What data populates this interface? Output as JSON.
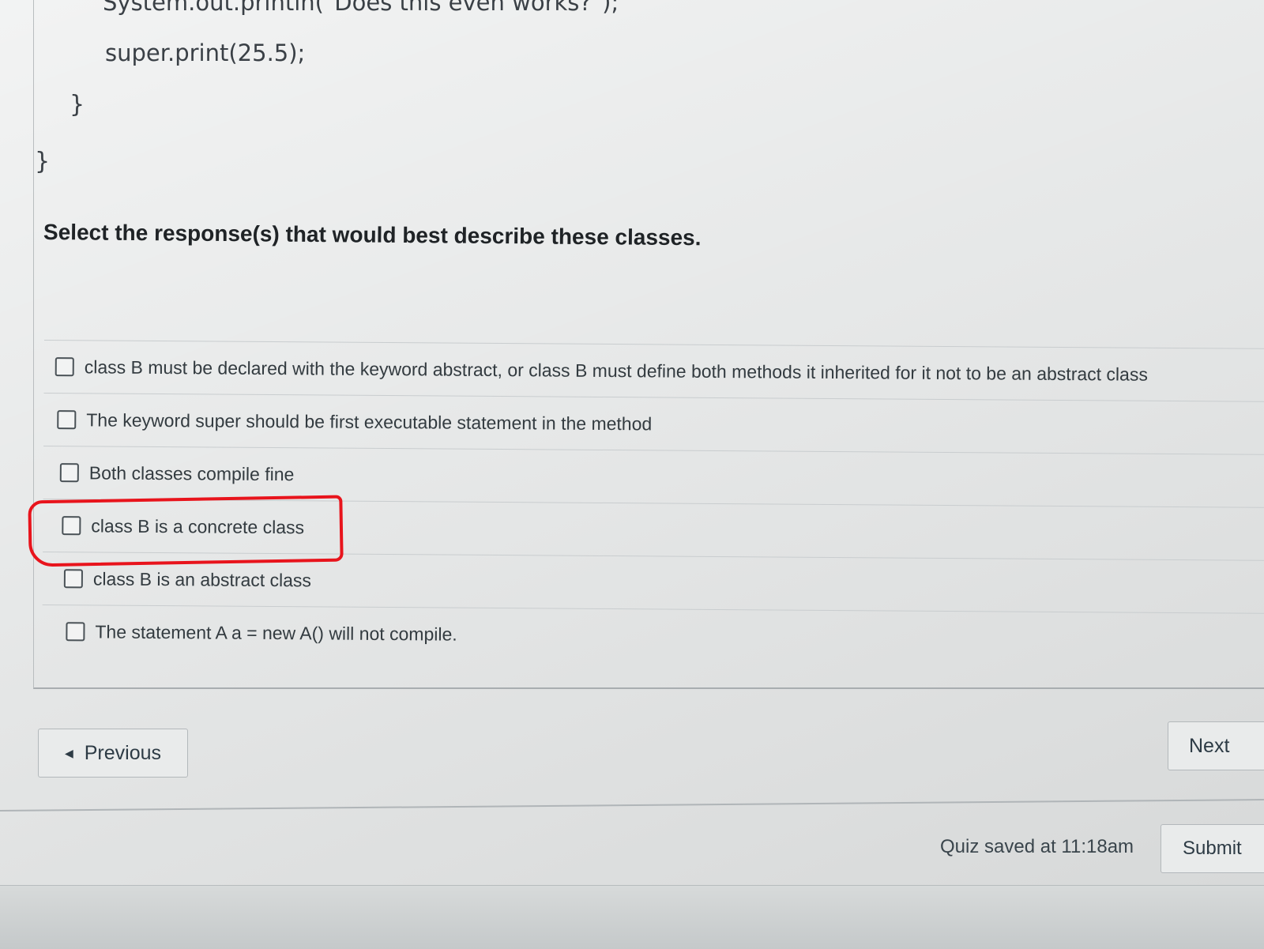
{
  "code": {
    "line1": "System.out.println(\"Does this even works?\");",
    "line2": "super.print(25.5);",
    "line3": "}",
    "line4": "}"
  },
  "question": {
    "prompt": "Select the response(s) that would best describe these classes."
  },
  "answers": [
    {
      "label": "class B must be declared with the keyword abstract, or class B must define both methods it inherited for it not to be an abstract class",
      "checked": false
    },
    {
      "label": "The keyword super should be first executable statement in the method",
      "checked": false
    },
    {
      "label": "Both classes compile fine",
      "checked": false
    },
    {
      "label": "class B is a concrete class",
      "checked": false
    },
    {
      "label": "class B is an abstract class",
      "checked": false
    },
    {
      "label": "The statement A a = new A() will not compile.",
      "checked": false
    }
  ],
  "navigation": {
    "previous_label": "Previous",
    "next_label": "Next"
  },
  "footer": {
    "save_status": "Quiz saved at 11:18am",
    "submit_label": "Submit"
  },
  "colors": {
    "highlight": "#e8141c"
  }
}
